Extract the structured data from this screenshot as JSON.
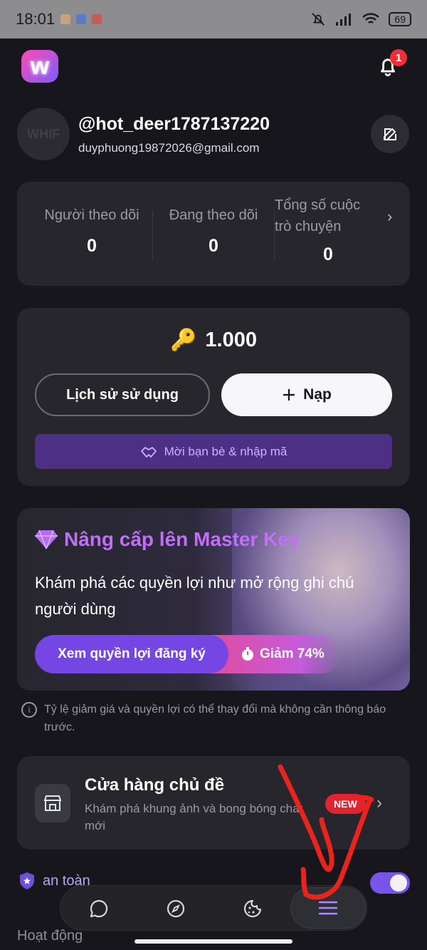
{
  "status_bar": {
    "time": "18:01",
    "battery": "69"
  },
  "header": {
    "logo_letter": "w",
    "notification_count": "1"
  },
  "profile": {
    "avatar_text": "WHIF",
    "username": "@hot_deer1787137220",
    "email": "duyphuong19872026@gmail.com"
  },
  "stats": {
    "followers_label": "Người theo dõi",
    "followers_value": "0",
    "following_label": "Đang theo dõi",
    "following_value": "0",
    "chats_label_line1": "Tổng số cuộc",
    "chats_label_line2": "trò chuyện",
    "chats_value": "0"
  },
  "wallet": {
    "key_icon": "🔑",
    "balance": "1.000",
    "history_label": "Lịch sử sử dụng",
    "topup_label": "Nạp",
    "invite_label": "Mời bạn bè & nhập mã"
  },
  "promo": {
    "title": "Nâng cấp lên Master Key",
    "description": "Khám phá các quyền lợi như mở rộng ghi chú người dùng",
    "cta_label": "Xem quyền lợi đăng ký",
    "discount_label": "Giảm 74%"
  },
  "notice": "Tỷ lệ giảm giá và quyền lợi có thể thay đổi mà không cần thông báo trước.",
  "shop": {
    "title": "Cửa hàng chủ đề",
    "subtitle": "Khám phá khung ảnh và bong bóng chat mới",
    "badge": "NEW"
  },
  "safe_mode": {
    "label": "an toàn",
    "enabled": true
  },
  "activity_label": "Hoạt động",
  "colors": {
    "accent": "#7a54e8",
    "badge_red": "#e3242f",
    "promo_title": "#c26dfb"
  }
}
